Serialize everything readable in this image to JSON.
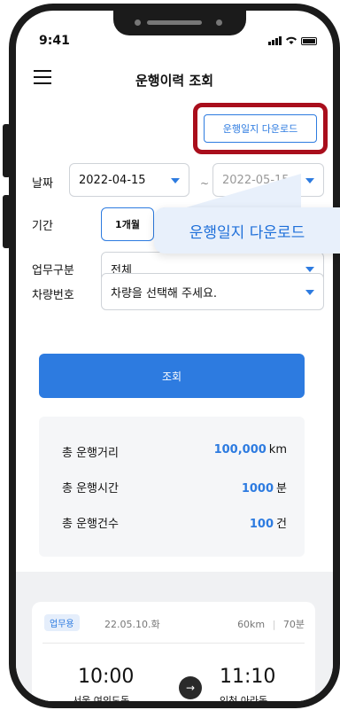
{
  "status_bar": {
    "time": "9:41"
  },
  "header": {
    "title": "운행이력 조회"
  },
  "download_button": {
    "label": "운행일지 다운로드"
  },
  "form": {
    "date_label": "날짜",
    "start_date": "2022-04-15",
    "date_separator": "~",
    "end_date": "2022-05-15",
    "period_label": "기간",
    "period_selected": "1개월",
    "work_type_label": "업무구분",
    "work_type_value": "전체",
    "vehicle_label": "차량번호",
    "vehicle_placeholder": "차량을 선택해 주세요."
  },
  "search_button": {
    "label": "조회"
  },
  "summary": {
    "distance_label": "총 운행거리",
    "distance_value": "100,000",
    "distance_unit": "km",
    "time_label": "총 운행시간",
    "time_value": "1000",
    "time_unit": "분",
    "count_label": "총 운행건수",
    "count_value": "100",
    "count_unit": "건"
  },
  "history": [
    {
      "badge": "업무용",
      "date": "22.05.10.화",
      "distance": "60km",
      "duration": "70분",
      "start_time": "10:00",
      "start_place": "서울 여의도동",
      "end_time": "11:10",
      "end_place": "인천 아라동"
    }
  ],
  "callout": {
    "text": "운행일지 다운로드"
  },
  "colors": {
    "accent": "#2d7be0",
    "highlight": "#a90e1c",
    "callout_bg": "#e8f0fb"
  }
}
